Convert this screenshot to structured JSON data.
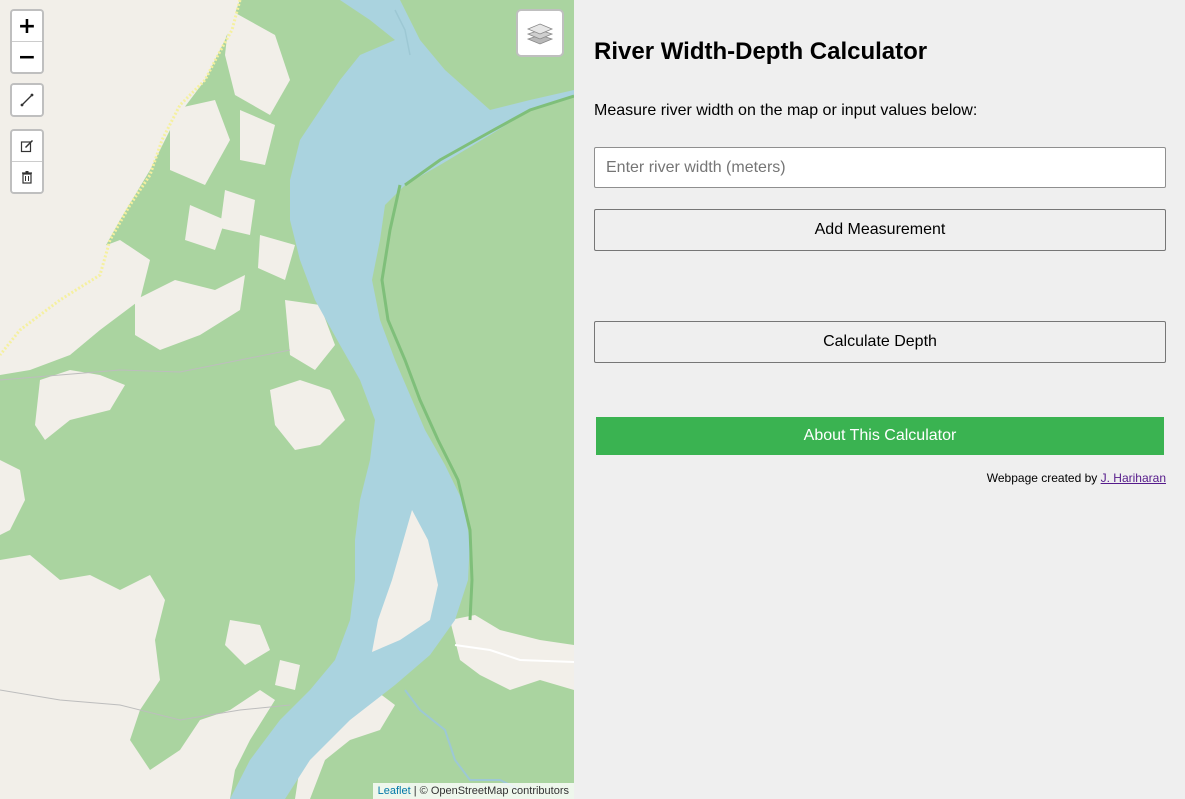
{
  "map": {
    "controls": {
      "zoom_in": "+",
      "zoom_out": "−"
    },
    "icons": {
      "measure": "ruler-line-icon",
      "edit": "edit-icon",
      "delete": "trash-icon",
      "layers": "layers-icon"
    },
    "attribution": {
      "leaflet": "Leaflet",
      "separator": " | © ",
      "osm": "OpenStreetMap contributors"
    },
    "colors": {
      "land": "#aad4a0",
      "cleared": "#f2efe9",
      "water": "#aad3df"
    }
  },
  "panel": {
    "title": "River Width-Depth Calculator",
    "instructions": "Measure river width on the map or input values below:",
    "width_input": {
      "placeholder": "Enter river width (meters)",
      "value": ""
    },
    "add_button": "Add Measurement",
    "calculate_button": "Calculate Depth",
    "about_button": "About This Calculator",
    "credit_prefix": "Webpage created by ",
    "credit_author": "J. Hariharan"
  },
  "colors": {
    "accent": "#3ab351",
    "link": "#551a8b"
  }
}
